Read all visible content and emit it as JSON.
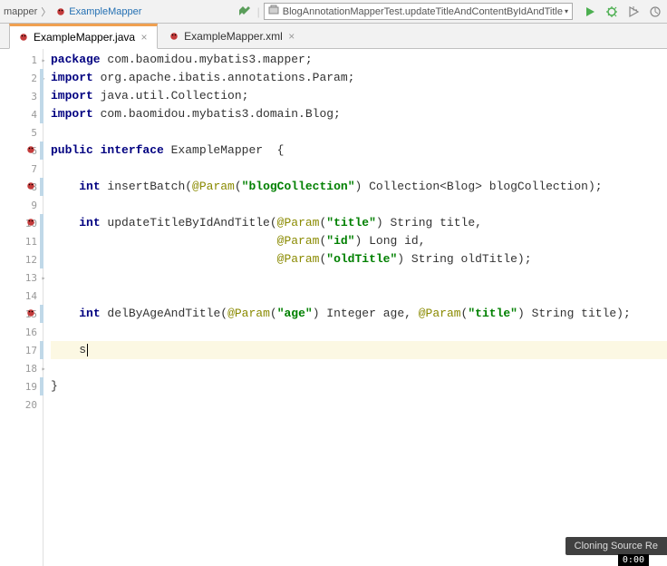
{
  "toolbar": {
    "breadcrumb": {
      "folder": "mapper",
      "file": "ExampleMapper"
    },
    "runConfig": "BlogAnnotationMapperTest.updateTitleAndContentByIdAndTitle"
  },
  "tabs": [
    {
      "label": "ExampleMapper.java",
      "active": true
    },
    {
      "label": "ExampleMapper.xml",
      "active": false
    }
  ],
  "code": {
    "lines": [
      {
        "n": "1",
        "tokens": [
          [
            "kw",
            "package"
          ],
          [
            "plain",
            " com.baomidou.mybatis3.mapper;"
          ]
        ]
      },
      {
        "n": "2",
        "tokens": [
          [
            "kw",
            "import"
          ],
          [
            "plain",
            " org.apache.ibatis.annotations."
          ],
          [
            "plain",
            "Param"
          ],
          [
            "plain",
            ";"
          ]
        ]
      },
      {
        "n": "3",
        "tokens": [
          [
            "kw",
            "import"
          ],
          [
            "plain",
            " java.util.Collection;"
          ]
        ]
      },
      {
        "n": "4",
        "tokens": [
          [
            "kw",
            "import"
          ],
          [
            "plain",
            " com.baomidou.mybatis3.domain.Blog;"
          ]
        ]
      },
      {
        "n": "5",
        "tokens": []
      },
      {
        "n": "6",
        "tokens": [
          [
            "kw",
            "public interface"
          ],
          [
            "plain",
            " ExampleMapper  {"
          ]
        ]
      },
      {
        "n": "7",
        "tokens": []
      },
      {
        "n": "8",
        "tokens": [
          [
            "plain",
            "    "
          ],
          [
            "kw",
            "int"
          ],
          [
            "plain",
            " insertBatch("
          ],
          [
            "ann",
            "@Param"
          ],
          [
            "plain",
            "("
          ],
          [
            "str",
            "\"blogCollection\""
          ],
          [
            "plain",
            ") Collection<Blog> blogCollection);"
          ]
        ]
      },
      {
        "n": "9",
        "tokens": []
      },
      {
        "n": "10",
        "tokens": [
          [
            "plain",
            "    "
          ],
          [
            "kw",
            "int"
          ],
          [
            "plain",
            " updateTitleByIdAndTitle("
          ],
          [
            "ann",
            "@Param"
          ],
          [
            "plain",
            "("
          ],
          [
            "str",
            "\"title\""
          ],
          [
            "plain",
            ") String title,"
          ]
        ]
      },
      {
        "n": "11",
        "tokens": [
          [
            "plain",
            "                                "
          ],
          [
            "ann",
            "@Param"
          ],
          [
            "plain",
            "("
          ],
          [
            "str",
            "\"id\""
          ],
          [
            "plain",
            ") Long id,"
          ]
        ]
      },
      {
        "n": "12",
        "tokens": [
          [
            "plain",
            "                                "
          ],
          [
            "ann",
            "@Param"
          ],
          [
            "plain",
            "("
          ],
          [
            "str",
            "\"oldTitle\""
          ],
          [
            "plain",
            ") String oldTitle);"
          ]
        ]
      },
      {
        "n": "13",
        "tokens": []
      },
      {
        "n": "14",
        "tokens": []
      },
      {
        "n": "15",
        "tokens": [
          [
            "plain",
            "    "
          ],
          [
            "kw",
            "int"
          ],
          [
            "plain",
            " delByAgeAndTitle("
          ],
          [
            "ann",
            "@Param"
          ],
          [
            "plain",
            "("
          ],
          [
            "str",
            "\"age\""
          ],
          [
            "plain",
            ") Integer age, "
          ],
          [
            "ann",
            "@Param"
          ],
          [
            "plain",
            "("
          ],
          [
            "str",
            "\"title\""
          ],
          [
            "plain",
            ") String title);"
          ]
        ]
      },
      {
        "n": "16",
        "tokens": []
      },
      {
        "n": "17",
        "tokens": [
          [
            "plain",
            "    s"
          ]
        ],
        "current": true
      },
      {
        "n": "18",
        "tokens": []
      },
      {
        "n": "19",
        "tokens": [
          [
            "plain",
            "}"
          ]
        ]
      },
      {
        "n": "20",
        "tokens": []
      }
    ]
  },
  "status": {
    "popup": "Cloning Source Re",
    "time": "0:00"
  }
}
